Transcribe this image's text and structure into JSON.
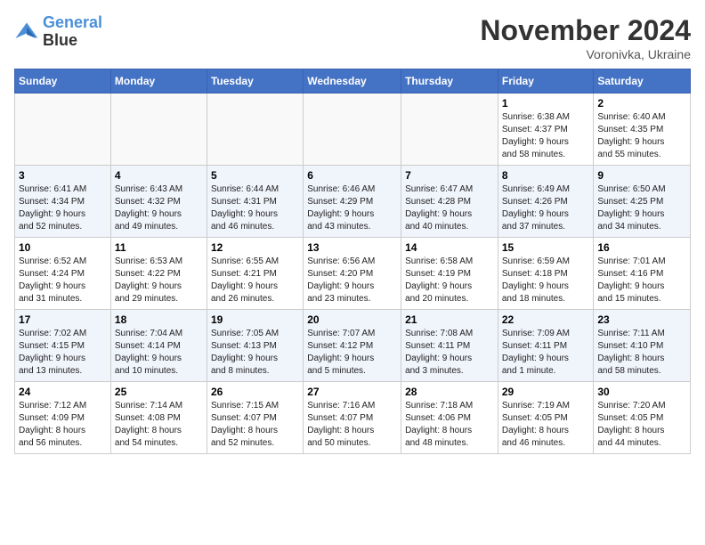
{
  "logo": {
    "line1": "General",
    "line2": "Blue"
  },
  "title": "November 2024",
  "subtitle": "Voronivka, Ukraine",
  "days_of_week": [
    "Sunday",
    "Monday",
    "Tuesday",
    "Wednesday",
    "Thursday",
    "Friday",
    "Saturday"
  ],
  "weeks": [
    [
      {
        "day": "",
        "info": ""
      },
      {
        "day": "",
        "info": ""
      },
      {
        "day": "",
        "info": ""
      },
      {
        "day": "",
        "info": ""
      },
      {
        "day": "",
        "info": ""
      },
      {
        "day": "1",
        "info": "Sunrise: 6:38 AM\nSunset: 4:37 PM\nDaylight: 9 hours\nand 58 minutes."
      },
      {
        "day": "2",
        "info": "Sunrise: 6:40 AM\nSunset: 4:35 PM\nDaylight: 9 hours\nand 55 minutes."
      }
    ],
    [
      {
        "day": "3",
        "info": "Sunrise: 6:41 AM\nSunset: 4:34 PM\nDaylight: 9 hours\nand 52 minutes."
      },
      {
        "day": "4",
        "info": "Sunrise: 6:43 AM\nSunset: 4:32 PM\nDaylight: 9 hours\nand 49 minutes."
      },
      {
        "day": "5",
        "info": "Sunrise: 6:44 AM\nSunset: 4:31 PM\nDaylight: 9 hours\nand 46 minutes."
      },
      {
        "day": "6",
        "info": "Sunrise: 6:46 AM\nSunset: 4:29 PM\nDaylight: 9 hours\nand 43 minutes."
      },
      {
        "day": "7",
        "info": "Sunrise: 6:47 AM\nSunset: 4:28 PM\nDaylight: 9 hours\nand 40 minutes."
      },
      {
        "day": "8",
        "info": "Sunrise: 6:49 AM\nSunset: 4:26 PM\nDaylight: 9 hours\nand 37 minutes."
      },
      {
        "day": "9",
        "info": "Sunrise: 6:50 AM\nSunset: 4:25 PM\nDaylight: 9 hours\nand 34 minutes."
      }
    ],
    [
      {
        "day": "10",
        "info": "Sunrise: 6:52 AM\nSunset: 4:24 PM\nDaylight: 9 hours\nand 31 minutes."
      },
      {
        "day": "11",
        "info": "Sunrise: 6:53 AM\nSunset: 4:22 PM\nDaylight: 9 hours\nand 29 minutes."
      },
      {
        "day": "12",
        "info": "Sunrise: 6:55 AM\nSunset: 4:21 PM\nDaylight: 9 hours\nand 26 minutes."
      },
      {
        "day": "13",
        "info": "Sunrise: 6:56 AM\nSunset: 4:20 PM\nDaylight: 9 hours\nand 23 minutes."
      },
      {
        "day": "14",
        "info": "Sunrise: 6:58 AM\nSunset: 4:19 PM\nDaylight: 9 hours\nand 20 minutes."
      },
      {
        "day": "15",
        "info": "Sunrise: 6:59 AM\nSunset: 4:18 PM\nDaylight: 9 hours\nand 18 minutes."
      },
      {
        "day": "16",
        "info": "Sunrise: 7:01 AM\nSunset: 4:16 PM\nDaylight: 9 hours\nand 15 minutes."
      }
    ],
    [
      {
        "day": "17",
        "info": "Sunrise: 7:02 AM\nSunset: 4:15 PM\nDaylight: 9 hours\nand 13 minutes."
      },
      {
        "day": "18",
        "info": "Sunrise: 7:04 AM\nSunset: 4:14 PM\nDaylight: 9 hours\nand 10 minutes."
      },
      {
        "day": "19",
        "info": "Sunrise: 7:05 AM\nSunset: 4:13 PM\nDaylight: 9 hours\nand 8 minutes."
      },
      {
        "day": "20",
        "info": "Sunrise: 7:07 AM\nSunset: 4:12 PM\nDaylight: 9 hours\nand 5 minutes."
      },
      {
        "day": "21",
        "info": "Sunrise: 7:08 AM\nSunset: 4:11 PM\nDaylight: 9 hours\nand 3 minutes."
      },
      {
        "day": "22",
        "info": "Sunrise: 7:09 AM\nSunset: 4:11 PM\nDaylight: 9 hours\nand 1 minute."
      },
      {
        "day": "23",
        "info": "Sunrise: 7:11 AM\nSunset: 4:10 PM\nDaylight: 8 hours\nand 58 minutes."
      }
    ],
    [
      {
        "day": "24",
        "info": "Sunrise: 7:12 AM\nSunset: 4:09 PM\nDaylight: 8 hours\nand 56 minutes."
      },
      {
        "day": "25",
        "info": "Sunrise: 7:14 AM\nSunset: 4:08 PM\nDaylight: 8 hours\nand 54 minutes."
      },
      {
        "day": "26",
        "info": "Sunrise: 7:15 AM\nSunset: 4:07 PM\nDaylight: 8 hours\nand 52 minutes."
      },
      {
        "day": "27",
        "info": "Sunrise: 7:16 AM\nSunset: 4:07 PM\nDaylight: 8 hours\nand 50 minutes."
      },
      {
        "day": "28",
        "info": "Sunrise: 7:18 AM\nSunset: 4:06 PM\nDaylight: 8 hours\nand 48 minutes."
      },
      {
        "day": "29",
        "info": "Sunrise: 7:19 AM\nSunset: 4:05 PM\nDaylight: 8 hours\nand 46 minutes."
      },
      {
        "day": "30",
        "info": "Sunrise: 7:20 AM\nSunset: 4:05 PM\nDaylight: 8 hours\nand 44 minutes."
      }
    ]
  ]
}
